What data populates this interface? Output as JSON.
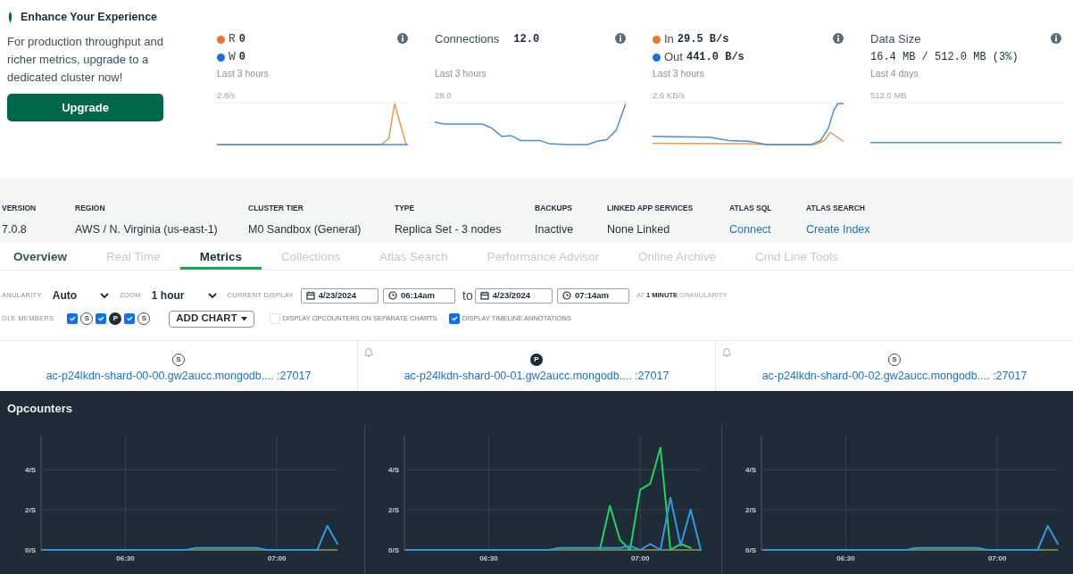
{
  "promo": {
    "title": "Enhance Your Experience",
    "text": "For production throughput and richer metrics, upgrade to a dedicated cluster now!",
    "button": "Upgrade"
  },
  "cards": [
    {
      "kind": "legend",
      "legend": [
        {
          "label": "R",
          "value": "0",
          "color": "#e8772e"
        },
        {
          "label": "W",
          "value": "0",
          "color": "#1f6fe0"
        }
      ],
      "period": "Last 3 hours",
      "max_label": "2.8/s"
    },
    {
      "kind": "inline",
      "title": "Connections",
      "value": "12.0",
      "period": "Last 3 hours",
      "max_label": "28.0"
    },
    {
      "kind": "legend",
      "legend": [
        {
          "label": "In",
          "value": "29.5 B/s",
          "color": "#e8772e"
        },
        {
          "label": "Out",
          "value": "441.0 B/s",
          "color": "#1f6fe0"
        }
      ],
      "period": "Last 3 hours",
      "max_label": "2.6 KB/s"
    },
    {
      "kind": "stacked",
      "title": "Data Size",
      "value": "16.4 MB / 512.0 MB (3%)",
      "period": "Last 4 days",
      "max_label": "512.0 MB"
    }
  ],
  "cluster_info": [
    {
      "label": "VERSION",
      "value": "7.0.8",
      "kind": "text"
    },
    {
      "label": "REGION",
      "value": "AWS / N. Virginia (us-east-1)",
      "kind": "text"
    },
    {
      "label": "CLUSTER TIER",
      "value": "M0 Sandbox (General)",
      "kind": "text"
    },
    {
      "label": "TYPE",
      "value": "Replica Set - 3 nodes",
      "kind": "text"
    },
    {
      "label": "BACKUPS",
      "value": "Inactive",
      "kind": "text"
    },
    {
      "label": "LINKED APP SERVICES",
      "value": "None Linked",
      "kind": "text"
    },
    {
      "label": "ATLAS SQL",
      "value": "Connect",
      "kind": "link"
    },
    {
      "label": "ATLAS SEARCH",
      "value": "Create Index",
      "kind": "link"
    }
  ],
  "tabs": [
    {
      "label": "Overview",
      "selected": false,
      "disabled": false
    },
    {
      "label": "Real Time",
      "selected": false,
      "disabled": true
    },
    {
      "label": "Metrics",
      "selected": true,
      "disabled": false
    },
    {
      "label": "Collections",
      "selected": false,
      "disabled": true
    },
    {
      "label": "Atlas Search",
      "selected": false,
      "disabled": true
    },
    {
      "label": "Performance Advisor",
      "selected": false,
      "disabled": true
    },
    {
      "label": "Online Archive",
      "selected": false,
      "disabled": true
    },
    {
      "label": "Cmd Line Tools",
      "selected": false,
      "disabled": true
    }
  ],
  "controls": {
    "granularity": {
      "label": "ANULARITY",
      "value": "Auto"
    },
    "zoom": {
      "label": "ZOOM",
      "value": "1 hour"
    },
    "current_display": {
      "label": "CURRENT DISPLAY",
      "start_date": "4/23/2024",
      "start_time": "06:14am",
      "separator": "to",
      "end_date": "4/23/2024",
      "end_time": "07:14am",
      "note": "AT **1 MINUTE** GRANULARITY"
    },
    "role_members": {
      "label": "OLE MEMBERS",
      "items": [
        {
          "role": "S",
          "kind": "secondary",
          "checked": true
        },
        {
          "role": "P",
          "kind": "primary",
          "checked": true
        },
        {
          "role": "S",
          "kind": "secondary",
          "checked": true
        }
      ]
    },
    "add_chart": "ADD CHART",
    "options": [
      {
        "label": "DISPLAY OPCOUNTERS ON SEPARATE CHARTS",
        "checked": false
      },
      {
        "label": "DISPLAY TIMELINE ANNOTATIONS",
        "checked": true
      }
    ]
  },
  "hosts": [
    {
      "role": "S",
      "kind": "secondary",
      "bell": false,
      "name": "ac-p24lkdn-shard-00-00.gw2aucc.mongodb.... :27017"
    },
    {
      "role": "P",
      "kind": "primary",
      "bell": true,
      "name": "ac-p24lkdn-shard-00-01.gw2aucc.mongodb.... :27017"
    },
    {
      "role": "S",
      "kind": "secondary",
      "bell": true,
      "name": "ac-p24lkdn-shard-00-02.gw2aucc.mongodb.... :27017"
    }
  ],
  "opcounters": {
    "title": "Opcounters",
    "charts": [
      {
        "chart_data": {
          "type": "line",
          "categories": [
            null,
            null,
            null,
            null,
            null,
            null,
            null,
            null,
            "06:30",
            null,
            null,
            null,
            null,
            null,
            null,
            null,
            null,
            null,
            null,
            null,
            null,
            null,
            null,
            "07:00",
            null,
            null,
            null,
            null,
            null,
            null
          ],
          "series": [
            {
              "color": "#2f9bdc",
              "values": [
                0,
                0,
                0,
                0,
                0,
                0,
                0,
                0,
                0,
                0,
                0,
                0,
                0,
                0,
                0,
                0.1,
                0.1,
                0.1,
                0.1,
                0.1,
                0.1,
                0.1,
                0,
                0,
                0,
                0,
                0,
                0,
                1.2,
                0.3
              ]
            }
          ],
          "grid": true,
          "ylim": [
            0,
            5.7
          ],
          "yticks": [
            {
              "value": 0,
              "label": "0/S"
            },
            {
              "value": 2,
              "label": "2/S"
            },
            {
              "value": 4,
              "label": "4/S"
            }
          ]
        }
      },
      {
        "chart_data": {
          "type": "line",
          "categories": [
            null,
            null,
            null,
            null,
            null,
            null,
            null,
            null,
            "06:30",
            null,
            null,
            null,
            null,
            null,
            null,
            null,
            null,
            null,
            null,
            null,
            null,
            null,
            null,
            "07:00",
            null,
            null,
            null,
            null,
            null,
            null
          ],
          "series": [
            {
              "color": "#2f9bdc",
              "values": [
                0,
                0,
                0,
                0,
                0,
                0,
                0,
                0,
                0,
                0,
                0,
                0,
                0,
                0,
                0,
                0.1,
                0.1,
                0.1,
                0.1,
                0.1,
                0.1,
                0.1,
                0.2,
                0,
                0.3,
                0,
                2.6,
                0.2,
                2.0,
                0
              ]
            },
            {
              "color": "#1fd35f",
              "values": [
                null,
                null,
                null,
                null,
                null,
                null,
                null,
                null,
                null,
                null,
                null,
                null,
                null,
                null,
                null,
                null,
                null,
                null,
                null,
                0,
                2.2,
                0.5,
                0,
                3.0,
                3.3,
                5.1,
                0,
                0.3,
                0.1,
                null
              ]
            }
          ],
          "grid": true,
          "ylim": [
            0,
            5.7
          ],
          "yticks": [
            {
              "value": 0,
              "label": "0/S"
            },
            {
              "value": 2,
              "label": "2/S"
            },
            {
              "value": 4,
              "label": "4/S"
            }
          ]
        }
      },
      {
        "chart_data": {
          "type": "line",
          "categories": [
            null,
            null,
            null,
            null,
            null,
            null,
            null,
            null,
            "06:30",
            null,
            null,
            null,
            null,
            null,
            null,
            null,
            null,
            null,
            null,
            null,
            null,
            null,
            null,
            "07:00",
            null,
            null,
            null,
            null,
            null,
            null
          ],
          "series": [
            {
              "color": "#2f9bdc",
              "values": [
                0,
                0,
                0,
                0,
                0,
                0,
                0,
                0,
                0,
                0,
                0,
                0,
                0,
                0,
                0,
                0.1,
                0.1,
                0.1,
                0.1,
                0.1,
                0.1,
                0.1,
                0,
                0,
                0,
                0,
                0,
                0,
                1.2,
                0.3
              ]
            }
          ],
          "grid": true,
          "ylim": [
            0,
            5.7
          ],
          "yticks": [
            {
              "value": 0,
              "label": "0/S"
            },
            {
              "value": 2,
              "label": "2/S"
            },
            {
              "value": 4,
              "label": "4/S"
            }
          ]
        }
      }
    ]
  }
}
